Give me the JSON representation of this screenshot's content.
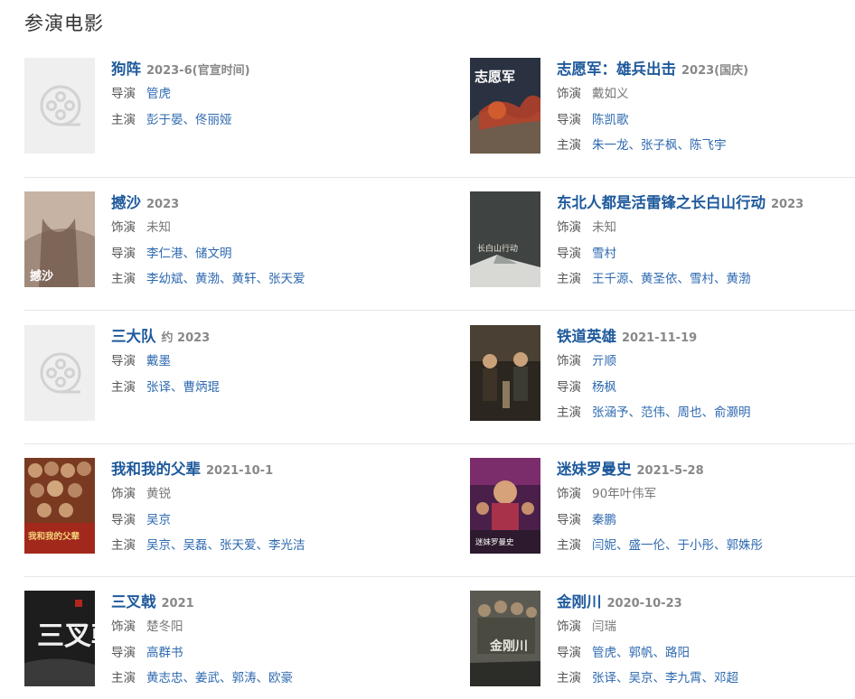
{
  "section": {
    "title": "参演电影"
  },
  "movies": [
    {
      "title": "狗阵",
      "date": "2023-6(官宣时间)",
      "poster_icon": "film-reel-placeholder-icon",
      "rows": [
        {
          "label": "导演",
          "values": [
            "管虎"
          ]
        },
        {
          "label": "主演",
          "values": [
            "彭于晏、佟丽娅"
          ]
        }
      ]
    },
    {
      "title": "志愿军：雄兵出击",
      "date": "2023(国庆)",
      "rows": [
        {
          "label": "饰演",
          "plain": "戴如义"
        },
        {
          "label": "导演",
          "values": [
            "陈凯歌"
          ]
        },
        {
          "label": "主演",
          "values": [
            "朱一龙、张子枫、陈飞宇"
          ]
        }
      ]
    },
    {
      "title": "撼沙",
      "date": "2023",
      "rows": [
        {
          "label": "饰演",
          "plain": "未知"
        },
        {
          "label": "导演",
          "values": [
            "李仁港、储文明"
          ]
        },
        {
          "label": "主演",
          "values": [
            "李幼斌、黄渤、黄轩、张天爱"
          ]
        }
      ]
    },
    {
      "title": "东北人都是活雷锋之长白山行动",
      "date": "2023",
      "rows": [
        {
          "label": "饰演",
          "plain": "未知"
        },
        {
          "label": "导演",
          "values": [
            "雪村"
          ]
        },
        {
          "label": "主演",
          "values": [
            "王千源、黄圣依、雪村、黄渤"
          ]
        }
      ]
    },
    {
      "title": "三大队",
      "date": "约 2023",
      "poster_icon": "film-reel-placeholder-icon",
      "rows": [
        {
          "label": "导演",
          "values": [
            "戴墨"
          ]
        },
        {
          "label": "主演",
          "values": [
            "张译、曹炳琨"
          ]
        }
      ]
    },
    {
      "title": "铁道英雄",
      "date": "2021-11-19",
      "rows": [
        {
          "label": "饰演",
          "values": [
            "亓顺"
          ]
        },
        {
          "label": "导演",
          "values": [
            "杨枫"
          ]
        },
        {
          "label": "主演",
          "values": [
            "张涵予、范伟、周也、俞灏明"
          ]
        }
      ]
    },
    {
      "title": "我和我的父辈",
      "date": "2021-10-1",
      "rows": [
        {
          "label": "饰演",
          "plain": "黄锐"
        },
        {
          "label": "导演",
          "values": [
            "吴京"
          ]
        },
        {
          "label": "主演",
          "values": [
            "吴京、吴磊、张天爱、李光洁"
          ]
        }
      ]
    },
    {
      "title": "迷妹罗曼史",
      "date": "2021-5-28",
      "rows": [
        {
          "label": "饰演",
          "plain": "90年叶伟军"
        },
        {
          "label": "导演",
          "values": [
            "秦鹏"
          ]
        },
        {
          "label": "主演",
          "values": [
            "闫妮、盛一伦、于小彤、郭姝彤"
          ]
        }
      ]
    },
    {
      "title": "三叉戟",
      "date": "2021",
      "rows": [
        {
          "label": "饰演",
          "plain": "楚冬阳"
        },
        {
          "label": "导演",
          "values": [
            "高群书"
          ]
        },
        {
          "label": "主演",
          "values": [
            "黄志忠、姜武、郭涛、欧豪"
          ]
        }
      ]
    },
    {
      "title": "金刚川",
      "date": "2020-10-23",
      "rows": [
        {
          "label": "饰演",
          "plain": "闫瑞"
        },
        {
          "label": "导演",
          "values": [
            "管虎、郭帆、路阳"
          ]
        },
        {
          "label": "主演",
          "values": [
            "张译、吴京、李九霄、邓超"
          ]
        }
      ]
    }
  ],
  "poster_texts": {
    "zhiyuanjun": "志愿军",
    "hansha": "撼沙",
    "dongbei": "长白山行动",
    "fubei": "我和我的父辈",
    "mimei": "迷妹罗曼史",
    "sanchaji": "三叉戟",
    "jingangchuan": "金刚川"
  },
  "colors": {
    "link": "#1f5a9c",
    "accent": "#2e69b0",
    "muted": "#888888"
  }
}
